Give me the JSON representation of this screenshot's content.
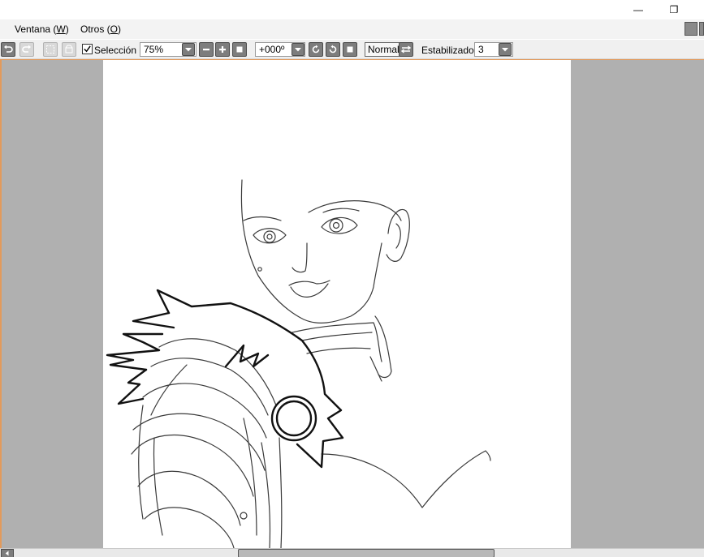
{
  "window": {
    "minimize_glyph": "—",
    "restore_glyph": "❐"
  },
  "menu": {
    "ventana_pre": "Ventana (",
    "ventana_key": "W",
    "ventana_post": ")",
    "otros_pre": "Otros (",
    "otros_key": "O",
    "otros_post": ")"
  },
  "toolbar": {
    "selection_label": "Selección",
    "selection_checked": true,
    "zoom_value": "75%",
    "rotation_value": "+000º",
    "blend_mode": "Normal",
    "stabilizer_label": "Estabilizador",
    "stabilizer_value": "3"
  },
  "icons": [
    "undo-icon",
    "redo-icon",
    "deselect-icon",
    "trim-icon",
    "dropdown-arrow-icon",
    "zoom-out-icon",
    "zoom-in-icon",
    "zoom-reset-icon",
    "rotate-left-icon",
    "rotate-right-icon",
    "rotate-reset-icon",
    "flip-horizontal-icon"
  ],
  "colors": {
    "workarea": "#b0b0b0",
    "canvas": "#ffffff",
    "accent_border": "#e29a5c",
    "button_dark": "#7d7d7d"
  },
  "scrollbar": {
    "horizontal_position": 0.34,
    "horizontal_visible_fraction": 0.36
  }
}
